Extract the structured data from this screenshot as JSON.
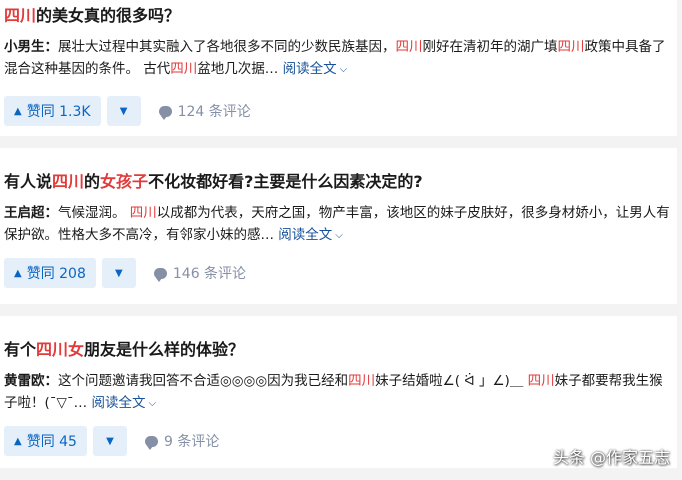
{
  "cards": [
    {
      "title_parts": [
        "四川",
        "的美女真的很多吗？"
      ],
      "author": "小男生：",
      "excerpt_parts": [
        "展壮大过程中其实融入了各地很多不同的少数民族基因，",
        "四川",
        "刚好在清初年的湖广填",
        "四川",
        "政策中具备了混合这种基因的条件。 古代",
        "四川",
        "盆地几次据…"
      ],
      "read_more": "阅读全文",
      "upvote": "赞同 1.3K",
      "comments": "124 条评论"
    },
    {
      "title_parts": [
        "有人说",
        "四川",
        "的",
        "女孩子",
        "不化妆都好看?主要是什么因素决定的?"
      ],
      "author": "王启超：",
      "excerpt_parts": [
        "气候湿润。 ",
        "四川",
        "以成都为代表，天府之国，物产丰富，该地区的妹子皮肤好，很多身材娇小，让男人有保护欲。性格大多不高冷，有邻家小妹的感…"
      ],
      "read_more": "阅读全文",
      "upvote": "赞同 208",
      "comments": "146 条评论"
    },
    {
      "title_parts": [
        "有个",
        "四川女",
        "朋友是什么样的体验？"
      ],
      "author": "黄雷欧：",
      "excerpt_parts": [
        "这个问题邀请我回答不合适◎◎◎◎因为我已经和",
        "四川",
        "妹子结婚啦∠( ᐛ 」∠)＿ ",
        "四川",
        "妹子都要帮我生猴子啦！(¯▽¯…"
      ],
      "read_more": "阅读全文",
      "upvote": "赞同 45",
      "comments": "9 条评论"
    }
  ],
  "icons": {
    "upvote": "triangle-up-icon",
    "downvote": "triangle-down-icon",
    "comment": "comment-bubble-icon",
    "chevron": "chevron-down-icon"
  },
  "colors": {
    "highlight": "#e33a3a",
    "accent": "#0a66c2",
    "vote_bg": "#e5eff9",
    "muted": "#8590a6",
    "link": "#175199"
  },
  "watermark": "头条 @作家五志"
}
